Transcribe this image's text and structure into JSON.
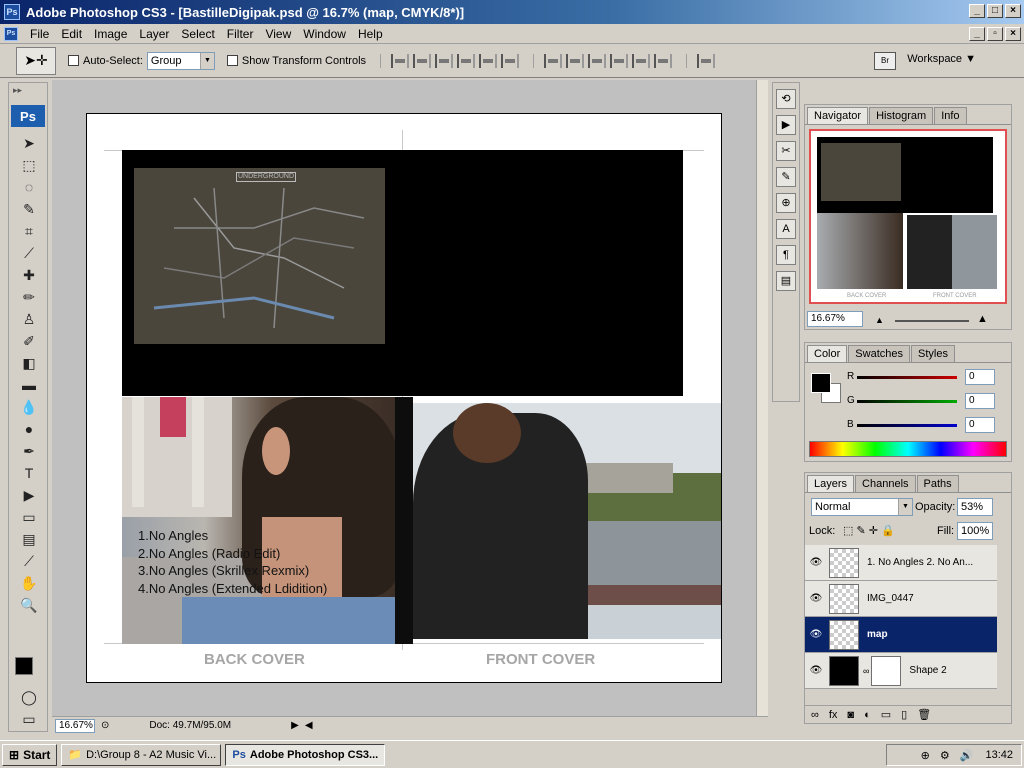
{
  "window": {
    "title": "Adobe Photoshop CS3 - [BastilleDigipak.psd @ 16.7% (map, CMYK/8*)]",
    "app_icon": "Ps"
  },
  "menu": [
    "File",
    "Edit",
    "Image",
    "Layer",
    "Select",
    "Filter",
    "View",
    "Window",
    "Help"
  ],
  "options": {
    "auto_select_label": "Auto-Select:",
    "auto_select_value": "Group",
    "show_transform_label": "Show Transform Controls",
    "workspace_label": "Workspace ▼"
  },
  "toolbox": {
    "badge": "Ps"
  },
  "document": {
    "map_title": "UNDERGROUND",
    "tracks": [
      "1.No Angles",
      "2.No Angles (Radio Edit)",
      "3.No Angles (Skrillex Rexmix)",
      "4.No Angles (Extended Ldidition)"
    ],
    "back_label": "BACK COVER",
    "front_label": "FRONT COVER"
  },
  "status": {
    "zoom": "16.67%",
    "doc": "Doc: 49.7M/95.0M"
  },
  "navigator": {
    "tabs": [
      "Navigator",
      "Histogram",
      "Info"
    ],
    "zoom": "16.67%",
    "thumb_back": "BACK COVER",
    "thumb_front": "FRONT COVER"
  },
  "color": {
    "tabs": [
      "Color",
      "Swatches",
      "Styles"
    ],
    "channels": [
      {
        "label": "R",
        "value": "0",
        "color": "#cc0000"
      },
      {
        "label": "G",
        "value": "0",
        "color": "#00aa00"
      },
      {
        "label": "B",
        "value": "0",
        "color": "#0000cc"
      }
    ]
  },
  "layers": {
    "tabs": [
      "Layers",
      "Channels",
      "Paths"
    ],
    "blend_mode": "Normal",
    "opacity_label": "Opacity:",
    "opacity": "53%",
    "lock_label": "Lock:",
    "fill_label": "Fill:",
    "fill": "100%",
    "items": [
      {
        "name": "1. No Angles 2. No An..."
      },
      {
        "name": "IMG_0447"
      },
      {
        "name": "map"
      },
      {
        "name": "Shape 2"
      }
    ]
  },
  "taskbar": {
    "start": "Start",
    "tasks": [
      "D:\\Group 8 - A2 Music Vi...",
      "Adobe Photoshop CS3..."
    ],
    "clock": "13:42"
  }
}
